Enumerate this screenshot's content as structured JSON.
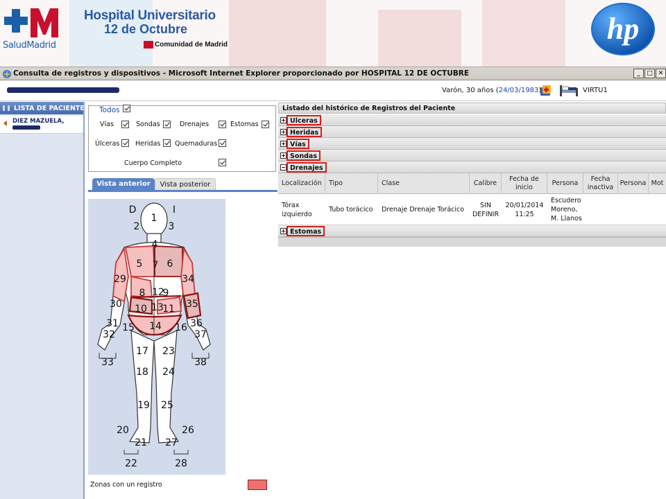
{
  "banner": {
    "salud_logo_text": "SaludMadrid",
    "hospital_title": "Hospital Universitario",
    "hospital_subtitle": "12 de Octubre",
    "comunidad": "Comunidad de Madrid",
    "brand_color": "#2a5aa0",
    "hp_logo_text": "hp"
  },
  "window": {
    "title": "Consulta de registros y dispositivos - Microsoft Internet Explorer proporcionado por HOSPITAL 12 DE OCTUBRE",
    "minimize": "_",
    "maximize": "□",
    "close": "✕"
  },
  "patient": {
    "summary": "Varón, 30 años (",
    "dob": "24/03/1983",
    "summary_end": ")",
    "workstation": "VIRTU1"
  },
  "sidebar": {
    "header": "LISTA DE PACIENTES",
    "patient_line1": "DIEZ MAZUELA,"
  },
  "filters": {
    "todos": "Todos",
    "vias": "Vías",
    "sondas": "Sondas",
    "drenajes": "Drenajes",
    "estomas": "Estomas",
    "ulceras": "Úlceras",
    "heridas": "Heridas",
    "quemaduras": "Quemaduras",
    "cuerpo_completo": "Cuerpo Completo"
  },
  "tabs": {
    "anterior": "Vista anterior",
    "posterior": "Vista posterior"
  },
  "bodymap": {
    "side_left": "D",
    "side_right": "I",
    "zones": [
      "1",
      "2",
      "3",
      "4",
      "5",
      "6",
      "7",
      "8",
      "9",
      "10",
      "11",
      "12",
      "13",
      "14",
      "15",
      "16",
      "17",
      "18",
      "19",
      "20",
      "21",
      "22",
      "23",
      "24",
      "25",
      "26",
      "27",
      "28",
      "29",
      "30",
      "31",
      "32",
      "33",
      "34",
      "35",
      "36",
      "37",
      "38"
    ],
    "zone_fill_color": "#f07070",
    "zone_border_color": "#8a1010",
    "legend": "Zonas con un registro"
  },
  "panel": {
    "title": "Listado del histórico de Registros del Paciente",
    "sections": [
      {
        "label": "Ulceras",
        "toggle": "+"
      },
      {
        "label": "Heridas",
        "toggle": "+"
      },
      {
        "label": "Vías",
        "toggle": "+"
      },
      {
        "label": "Sondas",
        "toggle": "+"
      },
      {
        "label": "Drenajes",
        "toggle": "−"
      },
      {
        "label": "Estomas",
        "toggle": "+"
      }
    ],
    "columns": [
      "Localización",
      "Tipo",
      "Clase",
      "Calibre",
      "Fecha de inicio",
      "Persona",
      "Fecha inactiva",
      "Persona",
      "Mot"
    ],
    "rows": [
      {
        "localizacion": "Tórax izquierdo",
        "tipo": "Tubo torácico",
        "clase": "Drenaje Drenaje Torácico",
        "calibre": "SIN DEFINIR",
        "fecha_inicio": "20/01/2014 11:25",
        "persona": "Escudero Moreno, M. Llanos",
        "fecha_inactiva": "",
        "persona2": "",
        "mot": ""
      }
    ]
  }
}
